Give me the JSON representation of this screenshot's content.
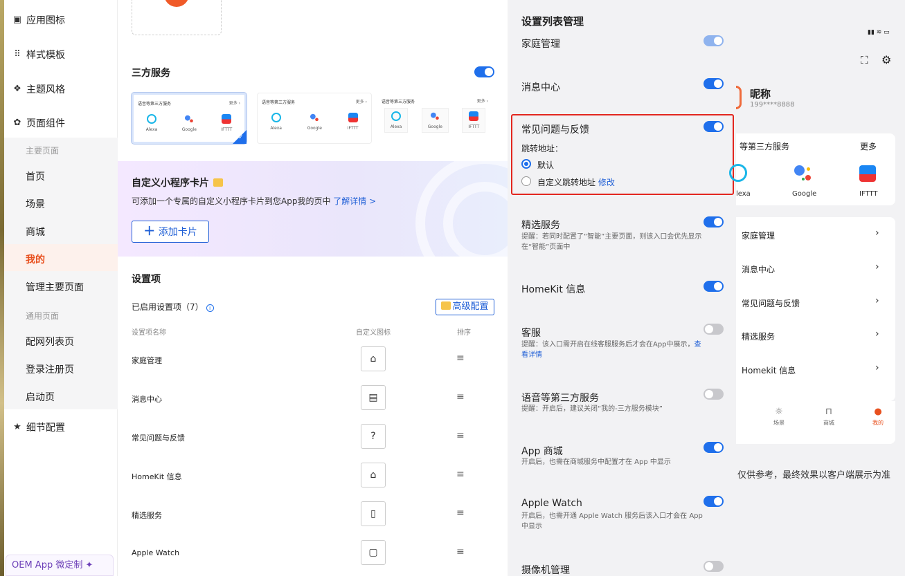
{
  "sidebar": {
    "groups": [
      {
        "label": "应用图标",
        "icon": "app-icon-icon"
      },
      {
        "label": "样式模板",
        "icon": "grid-icon"
      },
      {
        "label": "主题风格",
        "icon": "theme-icon"
      },
      {
        "label": "页面组件",
        "icon": "component-icon"
      },
      {
        "label": "细节配置",
        "icon": "star-icon"
      }
    ],
    "main_pages_head": "主要页面",
    "main_pages": [
      "首页",
      "场景",
      "商城",
      "我的",
      "管理主要页面"
    ],
    "common_pages_head": "通用页面",
    "common_pages": [
      "配网列表页",
      "登录注册页",
      "启动页"
    ],
    "oem_label": "OEM App 微定制"
  },
  "editor": {
    "third_party_title": "三方服务",
    "third_party_enabled": true,
    "template_cards": [
      {
        "title": "语音等第三方服务",
        "more": "更多 ›",
        "apps": [
          "Alexa",
          "Google",
          "IFTTT"
        ],
        "selected": true
      },
      {
        "title": "语音等第三方服务",
        "more": "更多 ›",
        "apps": [
          "Alexa",
          "Google",
          "IFTTT"
        ],
        "selected": false
      },
      {
        "title": "语音等第三方服务",
        "more": "更多 ›",
        "apps": [
          "Alexa",
          "Google",
          "IFTTT"
        ],
        "selected": false
      }
    ],
    "mini_program_title": "自定义小程序卡片",
    "mini_program_desc": "可添加一个专属的自定义小程序卡片到您App我的页中",
    "mini_program_link": "了解详情 >",
    "add_card_label": "添加卡片",
    "settings_title": "设置项",
    "enabled_label": "已启用设置项（7）",
    "advanced_label": "高级配置",
    "col_name": "设置项名称",
    "col_icon": "自定义图标",
    "col_sort": "排序",
    "rows": [
      {
        "name": "家庭管理",
        "icon": "⌂"
      },
      {
        "name": "消息中心",
        "icon": "▤"
      },
      {
        "name": "常见问题与反馈",
        "icon": "?"
      },
      {
        "name": "HomeKit 信息",
        "icon": "⌂"
      },
      {
        "name": "精选服务",
        "icon": "▯"
      },
      {
        "name": "Apple Watch",
        "icon": "▢"
      }
    ]
  },
  "list_panel": {
    "title": "设置列表管理",
    "items": [
      {
        "label": "家庭管理",
        "state": "light"
      },
      {
        "label": "消息中心",
        "state": "on"
      },
      {
        "label": "常见问题与反馈",
        "state": "on"
      },
      {
        "label": "精选服务",
        "state": "on",
        "note": "提醒：若同时配置了“智能”主要页面，则该入口会优先显示在“智能”页面中"
      },
      {
        "label": "HomeKit 信息",
        "state": "on"
      },
      {
        "label": "客服",
        "state": "off",
        "note": "提醒：该入口需开启在线客服服务后才会在App中展示，",
        "note_link": "查看详情"
      },
      {
        "label": "语音等第三方服务",
        "state": "off",
        "note": "提醒：开启后，建议关闭“我的-三方服务模块”"
      },
      {
        "label": "App 商城",
        "state": "on",
        "note": "开启后，也需在商城服务中配置才在 App 中显示"
      },
      {
        "label": "Apple Watch",
        "state": "on",
        "note": "开启后，也需开通 Apple Watch 服务后该入口才会在 App 中显示"
      },
      {
        "label": "摄像机管理",
        "state": "off"
      }
    ],
    "jump_label": "跳转地址：",
    "radio_default": "默认",
    "radio_custom": "自定义跳转地址",
    "radio_edit": "修改"
  },
  "preview": {
    "nickname": "昵称",
    "phone": "199****8888",
    "service_title": "语音等第三方服务",
    "service_title_visible": "等第三方服务",
    "more": "更多",
    "apps": [
      "lexa",
      "Google",
      "IFTTT"
    ],
    "menu": [
      "家庭管理",
      "消息中心",
      "常见问题与反馈",
      "精选服务",
      "Homekit 信息"
    ],
    "tabs": [
      "场景",
      "商城",
      "我的"
    ],
    "disclaimer": "仅供参考，最终效果以客户端展示为准"
  },
  "colors": {
    "accent": "#1f6feb",
    "active": "#e8501e",
    "highlight": "#e3261f"
  }
}
